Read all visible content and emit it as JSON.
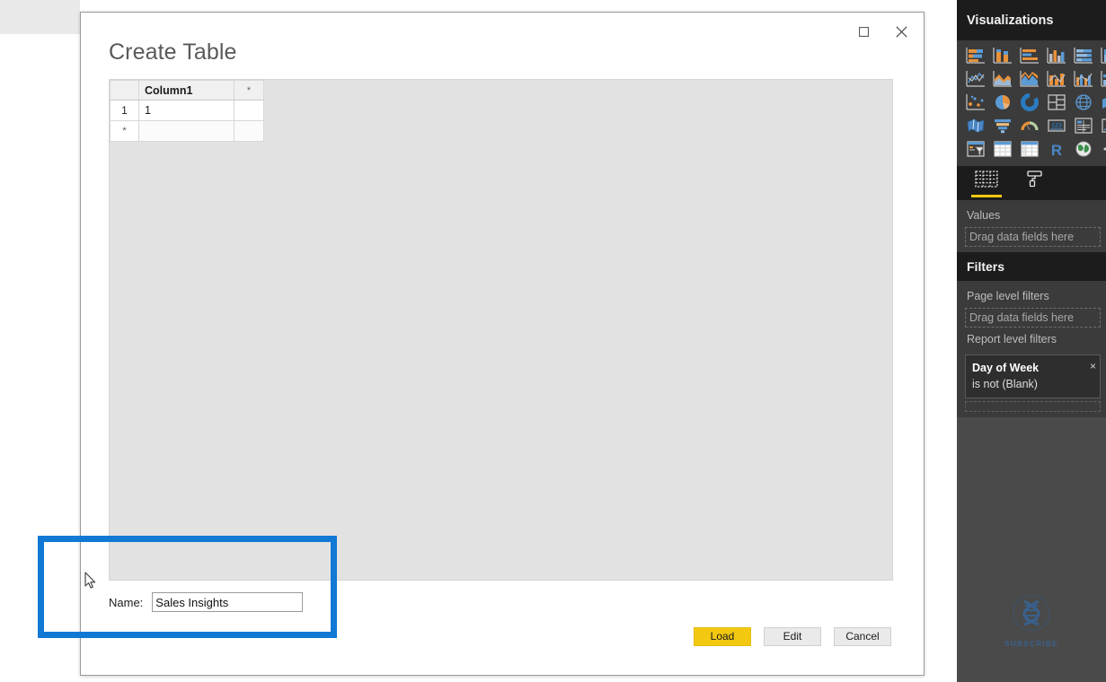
{
  "dialog": {
    "title": "Create Table",
    "window_controls": [
      {
        "name": "maximize",
        "label": "maximize-icon"
      },
      {
        "name": "close",
        "label": "close-icon"
      }
    ],
    "grid": {
      "column_headers": [
        "",
        "Column1",
        "*"
      ],
      "rows": [
        {
          "row_header": "1",
          "cells": [
            "1"
          ]
        },
        {
          "row_header": "*",
          "cells": [
            ""
          ]
        }
      ]
    },
    "name_field": {
      "label": "Name:",
      "value": "Sales Insights",
      "placeholder": ""
    },
    "buttons": [
      {
        "label": "Load",
        "style": "primary"
      },
      {
        "label": "Edit",
        "style": "default"
      },
      {
        "label": "Cancel",
        "style": "default"
      }
    ]
  },
  "annotation": {
    "color": "#1178d4",
    "shape": "rectangle-outline"
  },
  "visualizations": {
    "header": "Visualizations",
    "icons": [
      "stacked-bar-chart-icon",
      "stacked-column-chart-icon",
      "clustered-bar-chart-icon",
      "clustered-column-chart-icon",
      "100-percent-stacked-bar-chart-icon",
      "100-percent-stacked-column-chart-icon",
      "line-chart-icon",
      "area-chart-icon",
      "stacked-area-chart-icon",
      "line-and-stacked-column-chart-icon",
      "line-and-clustered-column-chart-icon",
      "ribbon-chart-icon",
      "scatter-chart-icon",
      "pie-chart-icon",
      "donut-chart-icon",
      "treemap-icon",
      "map-icon",
      "filled-map-icon",
      "shape-map-icon",
      "funnel-chart-icon",
      "gauge-icon",
      "card-icon",
      "multi-row-card-icon",
      "kpi-icon",
      "slicer-icon",
      "table-icon",
      "matrix-icon",
      "r-script-visual-icon",
      "arcgis-map-icon",
      "more-options-icon"
    ],
    "tabs": [
      {
        "name": "fields",
        "icon": "fields-grid-icon",
        "active": true
      },
      {
        "name": "format",
        "icon": "paint-roller-icon",
        "active": false
      }
    ],
    "values_section": {
      "label": "Values",
      "dropzone": "Drag data fields here"
    }
  },
  "filters": {
    "header": "Filters",
    "page_level": {
      "label": "Page level filters",
      "dropzone": "Drag data fields here"
    },
    "report_level": {
      "label": "Report level filters",
      "cards": [
        {
          "title": "Day of Week",
          "condition": "is not (Blank)",
          "close": "×"
        }
      ]
    }
  },
  "watermark": {
    "text": "SUBSCRIBE",
    "icon": "dna-helix-icon",
    "color": "#2f6fb5"
  }
}
